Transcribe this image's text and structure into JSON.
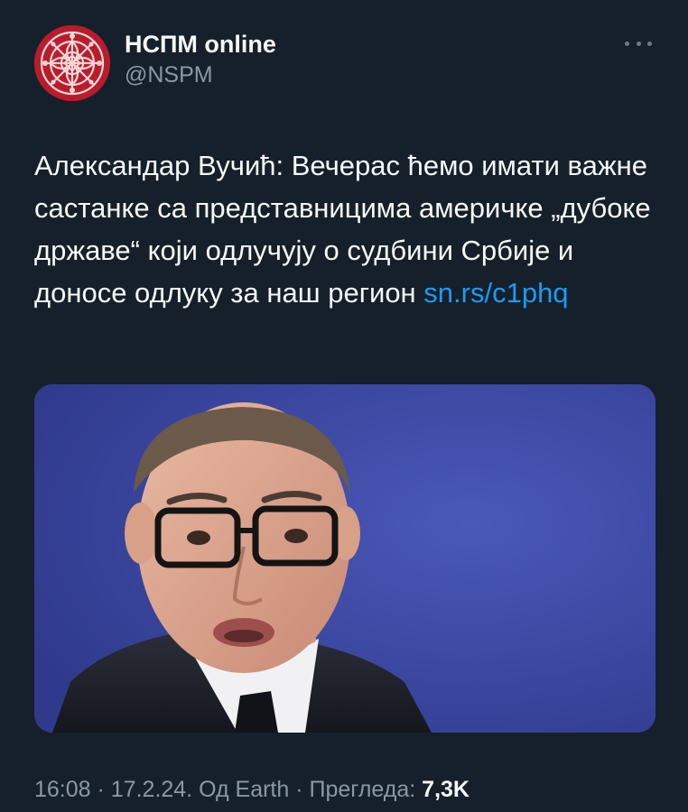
{
  "author": {
    "display_name": "НСПМ online",
    "handle": "@NSPM",
    "avatar_icon": "nspm-logo-icon",
    "avatar_color": "#b91c2c"
  },
  "more_icon": "more-horizontal-icon",
  "tweet": {
    "text": "Александар Вучић: Вечерас ћемо имати важне састанке са представницима америчке „дубоке државе“ који одлучују о судбини Србије и доносе одлуку за наш регион ",
    "link": "sn.rs/c1phq",
    "link_color": "#1d9bf0"
  },
  "media": {
    "type": "photo"
  },
  "meta": {
    "time": "16:08",
    "sep1": " · ",
    "date": "17.2.24.",
    "sep2": " ",
    "source": "Од Earth",
    "sep3": " · ",
    "views_label": "Прегледа: ",
    "views_count": "7,3K"
  },
  "colors": {
    "background": "#15202b",
    "text": "#f7f9f9",
    "secondary": "#8b98a5"
  }
}
